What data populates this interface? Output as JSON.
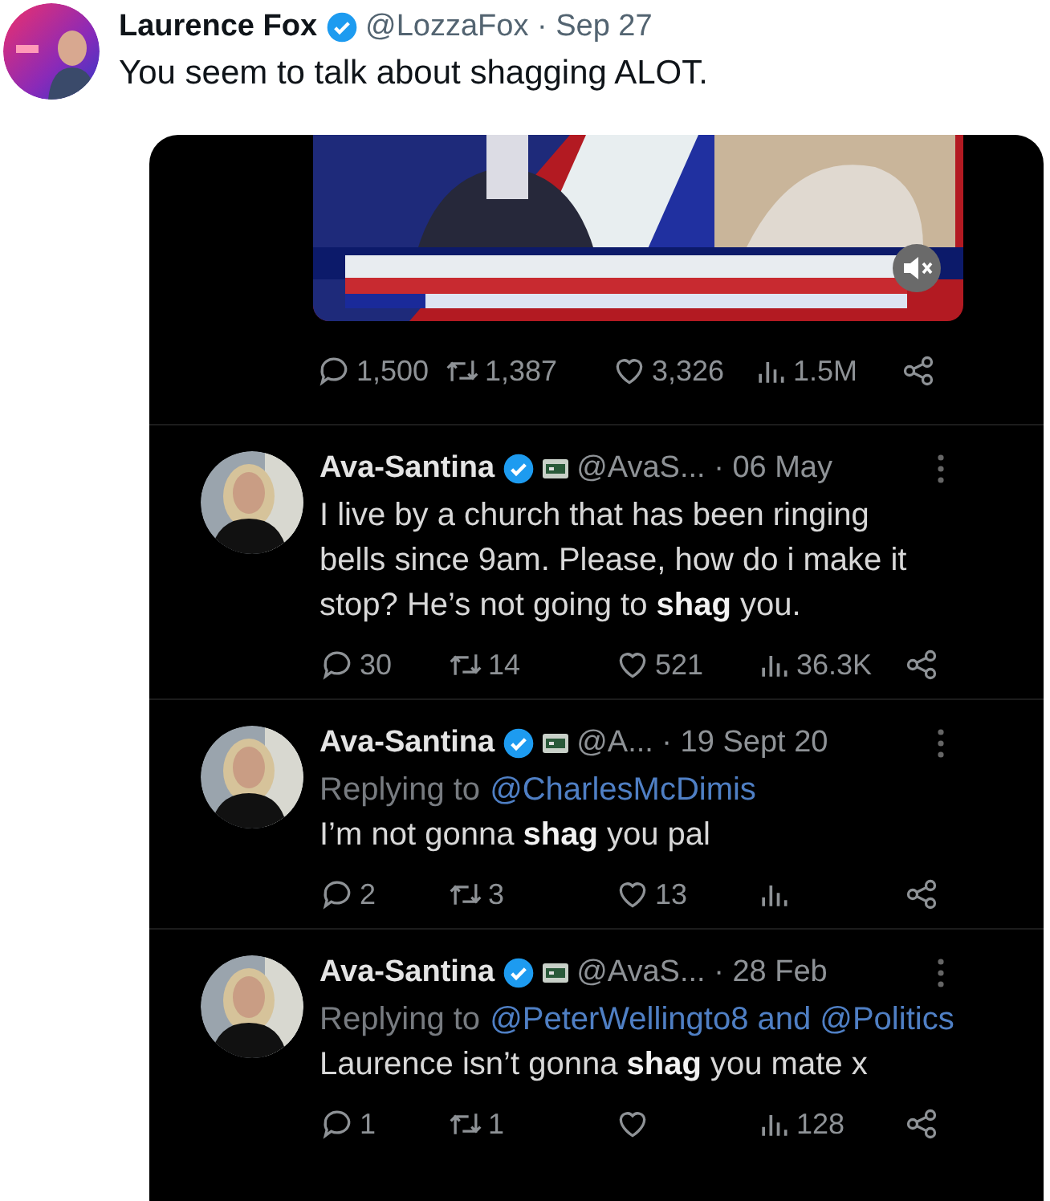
{
  "tweet": {
    "author": "Laurence Fox",
    "verified": true,
    "handle": "@LozzaFox",
    "date": "· Sep 27",
    "text": "You seem to talk about shagging ALOT."
  },
  "embedded": {
    "media": {
      "kind": "picture",
      "muted": true
    },
    "stats": [
      {
        "kind": "reply",
        "count": "1,500"
      },
      {
        "kind": "retweet",
        "count": "1,387"
      },
      {
        "kind": "like",
        "count": "3,326"
      },
      {
        "kind": "views",
        "count": "1.5M"
      },
      {
        "kind": "share"
      }
    ],
    "replies": [
      {
        "author": "Ava-Santina",
        "verified": true,
        "handle": "@AvaS...",
        "date": "· 06 May",
        "text": "I live by a church that has been ringing bells since 9am. Please, how do i make it stop? He’s not going to **shag** you.",
        "stats": [
          {
            "kind": "reply",
            "count": "30"
          },
          {
            "kind": "retweet",
            "count": "14"
          },
          {
            "kind": "like",
            "count": "521"
          },
          {
            "kind": "views",
            "count": "36.3K"
          },
          {
            "kind": "share"
          }
        ]
      },
      {
        "author": "Ava-Santina",
        "verified": true,
        "handle": "@A...",
        "date": "· 19 Sept 20",
        "replying_label": "Replying to",
        "replying_to": "@CharlesMcDimis",
        "text": "I’m not gonna **shag** you pal",
        "stats": [
          {
            "kind": "reply",
            "count": "2"
          },
          {
            "kind": "retweet",
            "count": "3"
          },
          {
            "kind": "like",
            "count": "13"
          },
          {
            "kind": "views"
          },
          {
            "kind": "share"
          }
        ]
      },
      {
        "author": "Ava-Santina",
        "verified": true,
        "handle": "@AvaS...",
        "date": "· 28 Feb",
        "replying_label": "Replying to",
        "replying_to": "@PeterWellingto8 and @Politics",
        "text": "Laurence isn’t gonna **shag** you mate x",
        "stats": [
          {
            "kind": "reply",
            "count": "1"
          },
          {
            "kind": "retweet",
            "count": "1"
          },
          {
            "kind": "like"
          },
          {
            "kind": "views",
            "count": "128"
          },
          {
            "kind": "share"
          }
        ]
      }
    ]
  }
}
